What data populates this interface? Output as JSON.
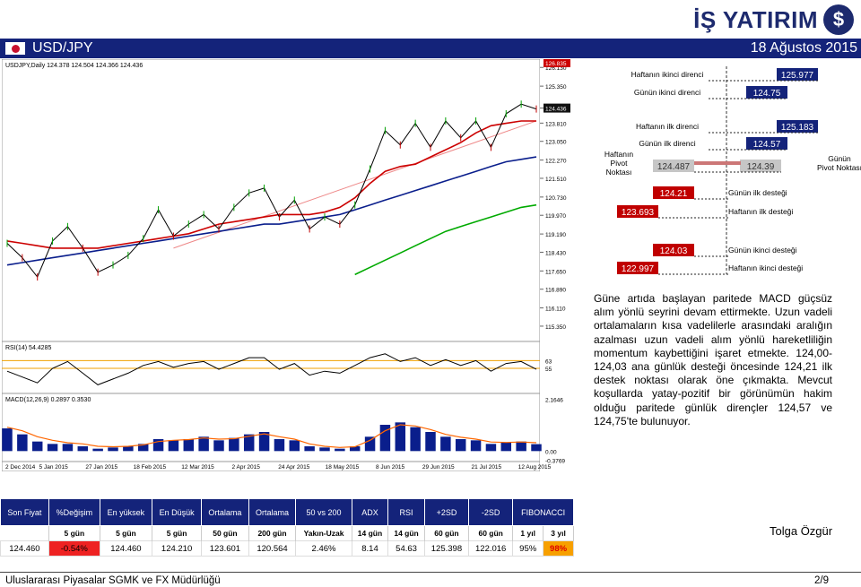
{
  "logo": {
    "text": "İŞ YATIRIM",
    "mark": "$"
  },
  "header": {
    "instrument": "USD/JPY",
    "date": "18 Ağustos 2015"
  },
  "chart_data": [
    {
      "type": "line",
      "title": "USDJPY,Daily  124.378 124.504 124.366 124.436",
      "x_ticks": [
        "2 Dec 2014",
        "5 Jan 2015",
        "27 Jan 2015",
        "18 Feb 2015",
        "12 Mar 2015",
        "2 Apr 2015",
        "24 Apr 2015",
        "18 May 2015",
        "8 Jun 2015",
        "29 Jun 2015",
        "21 Jul 2015",
        "12 Aug 2015"
      ],
      "y_ticks": [
        "126.130",
        "125.350",
        "124.436",
        "123.810",
        "123.050",
        "122.270",
        "121.510",
        "120.730",
        "119.970",
        "119.190",
        "118.430",
        "117.650",
        "116.890",
        "116.110",
        "115.350"
      ],
      "ylim": [
        114.9,
        126.4
      ],
      "last_price": "124.436",
      "max_marker": "126.835",
      "series": [
        {
          "name": "",
          "color": "#cc0000",
          "values": [
            118.9,
            118.8,
            118.7,
            118.6,
            118.6,
            118.6,
            118.6,
            118.7,
            118.8,
            118.9,
            119.0,
            119.1,
            119.2,
            119.4,
            119.6,
            119.7,
            119.8,
            119.9,
            120.0,
            120.0,
            120.0,
            120.1,
            120.3,
            120.7,
            121.3,
            121.8,
            122.0,
            122.1,
            122.4,
            122.7,
            123.0,
            123.4,
            123.7,
            123.8,
            123.9,
            123.9
          ]
        },
        {
          "name": "",
          "color": "#0a1e8c",
          "values": [
            117.9,
            118.0,
            118.1,
            118.2,
            118.3,
            118.4,
            118.5,
            118.6,
            118.7,
            118.8,
            118.9,
            119.0,
            119.1,
            119.2,
            119.3,
            119.4,
            119.5,
            119.6,
            119.6,
            119.7,
            119.8,
            119.9,
            120.0,
            120.2,
            120.4,
            120.6,
            120.8,
            121.0,
            121.2,
            121.4,
            121.6,
            121.8,
            122.0,
            122.2,
            122.3,
            122.4
          ]
        },
        {
          "name": "",
          "color": "#00aa00",
          "values": [
            null,
            null,
            null,
            null,
            null,
            null,
            null,
            null,
            null,
            null,
            null,
            null,
            null,
            null,
            null,
            null,
            null,
            null,
            null,
            null,
            null,
            null,
            null,
            117.5,
            117.8,
            118.1,
            118.4,
            118.7,
            119.0,
            119.3,
            119.5,
            119.7,
            119.9,
            120.1,
            120.3,
            120.4
          ]
        },
        {
          "name": "",
          "color": "#000000",
          "values": [
            118.8,
            118.2,
            117.4,
            118.9,
            119.5,
            118.6,
            117.6,
            117.9,
            118.3,
            119.0,
            120.2,
            119.1,
            119.6,
            120.0,
            119.4,
            120.3,
            120.9,
            121.1,
            119.9,
            120.6,
            119.4,
            119.9,
            119.6,
            120.4,
            121.9,
            123.5,
            122.9,
            123.8,
            122.8,
            123.9,
            123.2,
            123.9,
            122.8,
            124.2,
            124.6,
            124.4
          ]
        }
      ],
      "trendline": {
        "from": [
          11,
          118.6
        ],
        "to": [
          35,
          123.9
        ]
      }
    },
    {
      "type": "line",
      "title": "RSI(14) 54.4285",
      "y_ticks": [
        "63",
        "55"
      ],
      "ylim": [
        30,
        80
      ],
      "series": [
        {
          "name": "",
          "color": "#000000",
          "values": [
            52,
            46,
            40,
            55,
            62,
            50,
            38,
            44,
            50,
            58,
            62,
            56,
            60,
            62,
            54,
            60,
            66,
            66,
            54,
            60,
            48,
            52,
            50,
            58,
            66,
            70,
            62,
            66,
            58,
            64,
            58,
            63,
            52,
            60,
            62,
            54
          ]
        }
      ]
    },
    {
      "type": "bar",
      "title": "MACD(12,26,9) 0.2897 0.3530",
      "y_ticks": [
        "2.1646",
        "0.00",
        "-0.3769"
      ],
      "ylim": [
        -0.4,
        2.3
      ],
      "series": [
        {
          "name": "",
          "color": "#0a1e8c",
          "values": [
            0.95,
            0.7,
            0.4,
            0.3,
            0.3,
            0.2,
            0.1,
            0.15,
            0.2,
            0.3,
            0.5,
            0.45,
            0.5,
            0.6,
            0.45,
            0.55,
            0.7,
            0.8,
            0.5,
            0.45,
            0.2,
            0.15,
            0.1,
            0.2,
            0.6,
            1.1,
            1.2,
            1.0,
            0.8,
            0.6,
            0.5,
            0.45,
            0.3,
            0.35,
            0.4,
            0.29
          ]
        },
        {
          "name": "",
          "color": "#ff6600",
          "values": [
            1.0,
            0.85,
            0.6,
            0.45,
            0.35,
            0.3,
            0.2,
            0.18,
            0.2,
            0.26,
            0.4,
            0.45,
            0.48,
            0.55,
            0.5,
            0.52,
            0.62,
            0.72,
            0.6,
            0.5,
            0.3,
            0.2,
            0.15,
            0.18,
            0.45,
            0.85,
            1.1,
            1.05,
            0.9,
            0.7,
            0.58,
            0.5,
            0.38,
            0.36,
            0.38,
            0.35
          ]
        }
      ]
    }
  ],
  "levels": [
    {
      "label": "Haftanın ikinci direnci",
      "value": "125.977",
      "side": "right"
    },
    {
      "label": "Günün ikinci direnci",
      "value": "124.75",
      "side": "right"
    },
    {
      "label": "Haftanın ilk direnci",
      "value": "125.183",
      "side": "right"
    },
    {
      "label": "Günün ilk direnci",
      "value": "124.57",
      "side": "right"
    },
    {
      "label": "Haftanın Pivot Noktası",
      "value": "124.487",
      "side": "left"
    },
    {
      "label": "Günün Pivot Noktası",
      "value": "124.39",
      "side": "right"
    },
    {
      "label": "Günün ilk desteği",
      "value": "124.21",
      "side": "left"
    },
    {
      "label": "Haftanın ilk desteği",
      "value": "123.693",
      "side": "left"
    },
    {
      "label": "Günün ikinci desteği",
      "value": "124.03",
      "side": "left"
    },
    {
      "label": "Haftanın ikinci desteği",
      "value": "122.997",
      "side": "left"
    }
  ],
  "commentary": "Güne artıda başlayan paritede MACD güçsüz alım yönlü seyrini devam ettirmekte. Uzun vadeli ortalamaların kısa vadelilerle arasındaki aralığın azalması uzun vadeli alım yönlü hareketliliğin momentum kaybettiğini işaret etmekte. 124,00-124,03 ana günlük desteği öncesinde 124,21 ilk destek noktası olarak öne çıkmakta. Mevcut koşullarda yatay-pozitif bir görünümün hakim olduğu paritede günlük dirençler 124,57 ve 124,75'te bulunuyor.",
  "stats": {
    "headers": [
      "Son Fiyat",
      "%Değişim",
      "En yüksek",
      "En Düşük",
      "Ortalama",
      "Ortalama",
      "50 vs 200",
      "ADX",
      "RSI",
      "+2SD",
      "-2SD",
      "FIBONACCI"
    ],
    "sub": [
      "",
      "",
      "5 gün",
      "5 gün",
      "5 gün",
      "50 gün",
      "200 gün",
      "Yakın-Uzak",
      "14 gün",
      "14 gün",
      "60 gün",
      "60 gün",
      "1 yıl",
      "3 yıl"
    ],
    "row": [
      "124.460",
      "-0.54%",
      "124.460",
      "124.210",
      "123.601",
      "120.564",
      "2.46%",
      "8.14",
      "54.63",
      "125.398",
      "122.016",
      "95%",
      "98%"
    ]
  },
  "analyst": "Tolga Özgür",
  "footer": {
    "left": "Uluslararası Piyasalar SGMK ve FX Müdürlüğü",
    "right": "2/9"
  }
}
